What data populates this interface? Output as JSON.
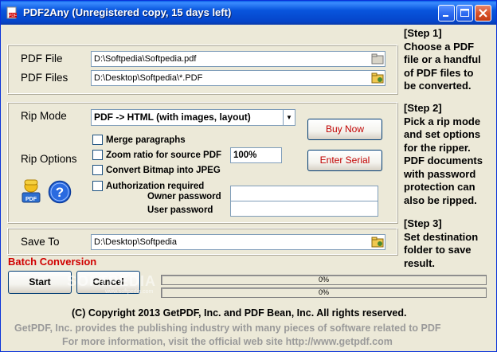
{
  "window": {
    "title": "PDF2Any (Unregistered copy, 15 days left)",
    "title_bg": "#0a55dd",
    "controls": [
      "minimize",
      "maximize",
      "close"
    ]
  },
  "files": {
    "pdf_file_label": "PDF File",
    "pdf_file_value": "D:\\Softpedia\\Softpedia.pdf",
    "pdf_files_label": "PDF Files",
    "pdf_files_value": "D:\\Desktop\\Softpedia\\*.PDF"
  },
  "steps": {
    "step1": [
      "[Step 1]",
      "Choose a PDF",
      "file or a handful",
      "of PDF files to",
      "be converted."
    ],
    "step2": [
      "[Step 2]",
      "Pick a rip mode",
      "and set options",
      "for the ripper.",
      "PDF documents",
      "with password",
      "protection can",
      "also be ripped."
    ],
    "step3": [
      "[Step 3]",
      "Set destination",
      "folder to save",
      "result."
    ]
  },
  "rip": {
    "mode_label": "Rip Mode",
    "mode_value": "PDF -> HTML (with images, layout)",
    "options_label": "Rip Options",
    "merge_paragraphs": "Merge paragraphs",
    "zoom_ratio": "Zoom ratio for source PDF",
    "zoom_value": "100%",
    "convert_bitmap": "Convert Bitmap into JPEG",
    "authorization": "Authorization required",
    "owner_password_label": "Owner password",
    "user_password_label": "User password",
    "buy_now": "Buy Now",
    "enter_serial": "Enter Serial"
  },
  "save": {
    "label": "Save To",
    "value": "D:\\Desktop\\Softpedia"
  },
  "batch": {
    "label": "Batch Conversion",
    "start": "Start",
    "cancel": "Cancel",
    "progress1_text": "0%",
    "progress2_text": "0%",
    "progress1": 0,
    "progress2": 0
  },
  "footer": {
    "copyright": "(C) Copyright 2013 GetPDF, Inc. and PDF Bean, Inc.  All rights reserved.",
    "line2": "GetPDF, Inc. provides the publishing industry with many pieces of software related to PDF",
    "line3": "For more information, visit the official web site http://www.getpdf.com"
  },
  "watermark": {
    "text": "SOFTPEDIA",
    "small": "www.softpedia.com"
  },
  "colors": {
    "accent_red": "#d00000",
    "progress_fill": "#3169c6",
    "window_bg": "#ece9d8"
  }
}
